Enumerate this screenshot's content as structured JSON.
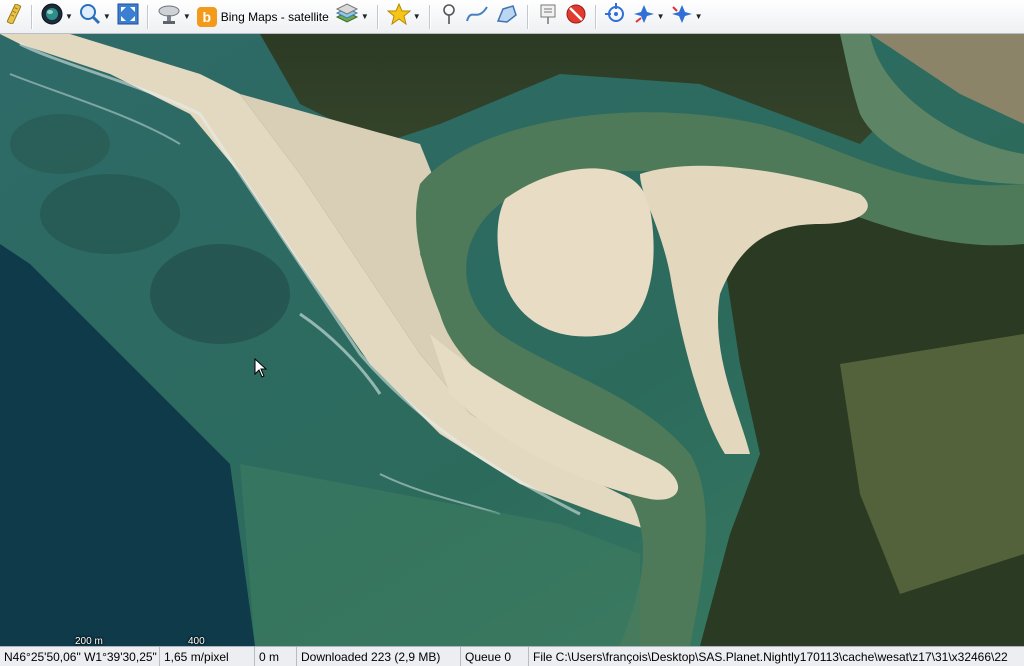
{
  "toolbar": {
    "map_type_label": "Bing Maps - satellite",
    "buttons": [
      {
        "name": "ruler-icon"
      },
      {
        "name": "globe-icon"
      },
      {
        "name": "zoom-icon"
      },
      {
        "name": "fullscreen-icon"
      },
      {
        "name": "satellite-dish-icon"
      },
      {
        "name": "bing-maps-icon"
      },
      {
        "name": "layers-icon"
      },
      {
        "name": "favorites-star-icon"
      },
      {
        "name": "placemark-icon"
      },
      {
        "name": "path-icon"
      },
      {
        "name": "polygon-icon"
      },
      {
        "name": "label-icon"
      },
      {
        "name": "delete-icon"
      },
      {
        "name": "gps-icon"
      },
      {
        "name": "gps-track-icon"
      },
      {
        "name": "gps-settings-icon"
      }
    ],
    "bing_letter": "b"
  },
  "map": {
    "scale": {
      "label_1": "200 m",
      "label_2": "400 m"
    }
  },
  "status": {
    "coordinates": "N46°25'50,06\" W1°39'30,25\"",
    "resolution": "1,65 m/pixel",
    "distance": "0 m",
    "downloaded": "Downloaded 223 (2,9 MB)",
    "queue": "Queue 0",
    "file": "File C:\\Users\\françois\\Desktop\\SAS.Planet.Nightly170113\\cache\\wesat\\z17\\31\\x32466\\22"
  }
}
